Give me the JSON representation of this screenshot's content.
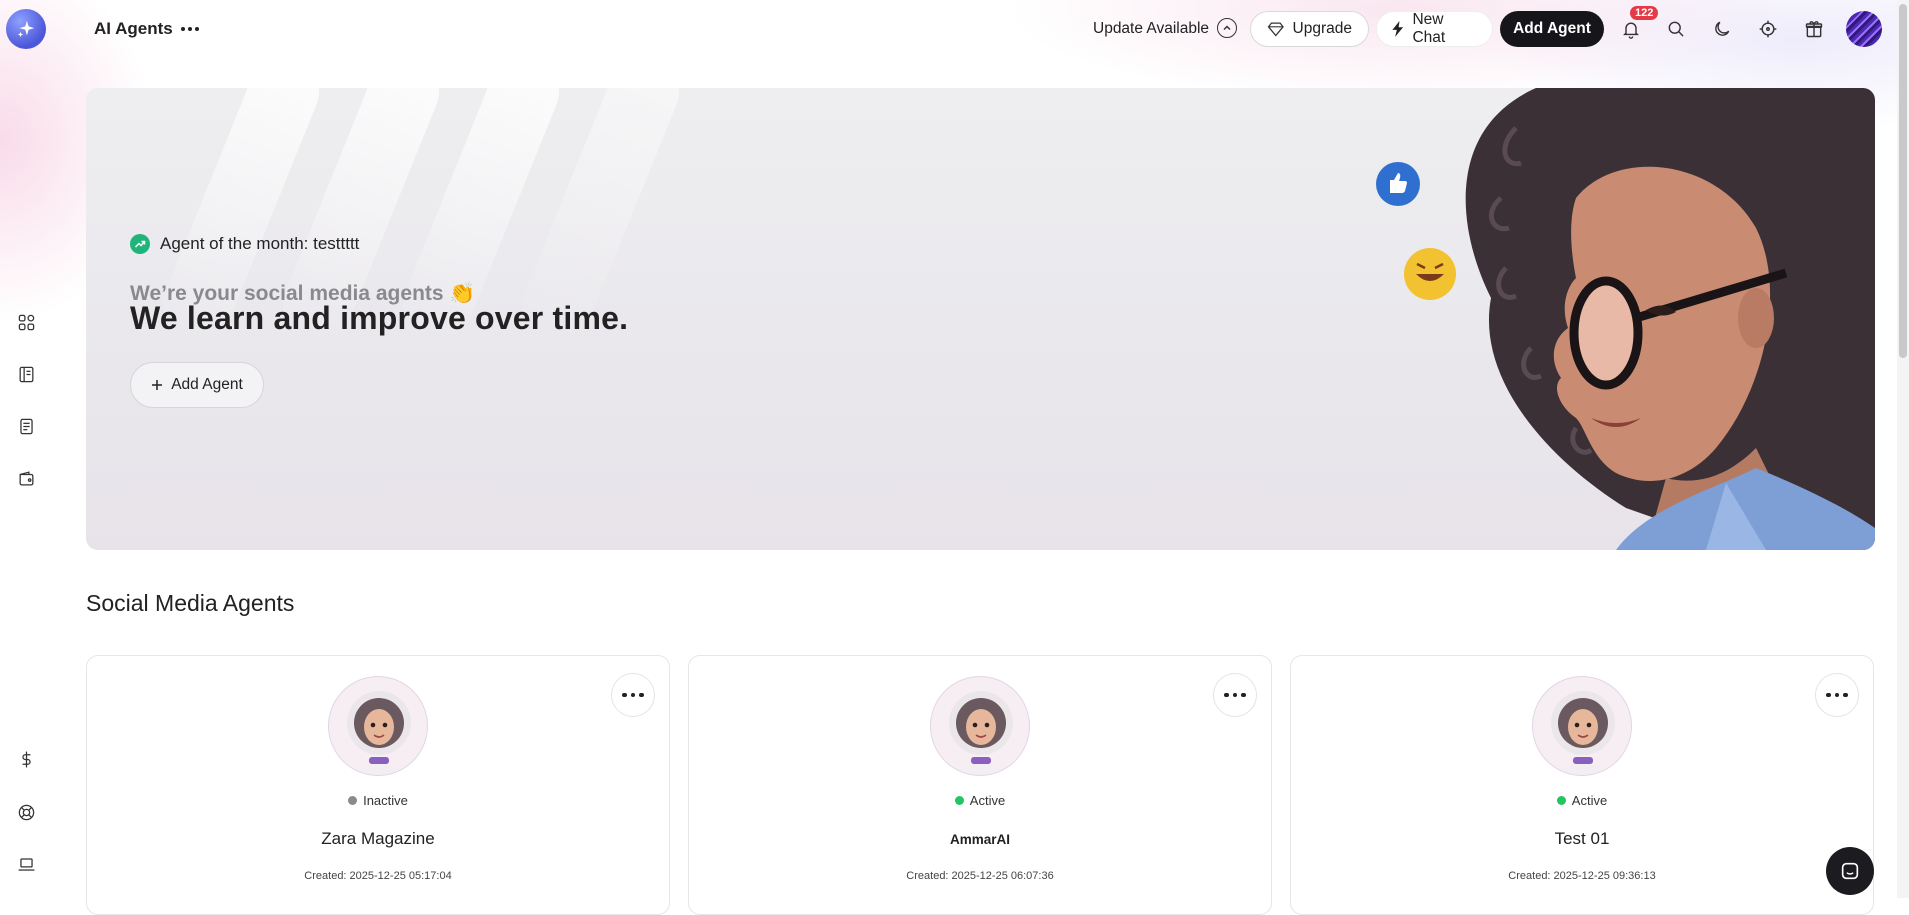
{
  "header": {
    "title": "AI Agents",
    "update_label": "Update Available",
    "upgrade_label": "Upgrade",
    "new_chat_label": "New Chat",
    "add_agent_label": "Add Agent",
    "notification_count": "122"
  },
  "sidebar": {
    "items": [
      {
        "icon": "grid-icon"
      },
      {
        "icon": "book-icon"
      },
      {
        "icon": "document-icon"
      },
      {
        "icon": "wallet-icon"
      },
      {
        "icon": "dollar-icon"
      },
      {
        "icon": "lifebuoy-icon"
      },
      {
        "icon": "laptop-icon"
      }
    ]
  },
  "hero": {
    "agent_of_month": "Agent of the month: testtttt",
    "subtitle": "We’re your social media agents 👏",
    "title": "We learn and improve over time.",
    "add_agent_label": "Add Agent"
  },
  "section": {
    "title": "Social Media Agents"
  },
  "agents": [
    {
      "status": "Inactive",
      "status_color": "#8a8a8e",
      "name": "Zara Magazine",
      "created": "Created: 2025-12-25 05:17:04"
    },
    {
      "status": "Active",
      "status_color": "#22c55e",
      "name": "AmmarAI",
      "created": "Created: 2025-12-25 06:07:36"
    },
    {
      "status": "Active",
      "status_color": "#22c55e",
      "name": "Test 01",
      "created": "Created: 2025-12-25 09:36:13"
    }
  ],
  "colors": {
    "accent_dark": "#16161a",
    "badge_red": "#e63946",
    "aotm_green": "#1fb47a"
  }
}
